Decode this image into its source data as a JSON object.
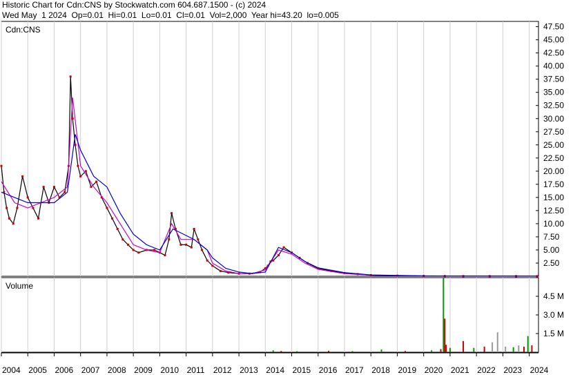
{
  "header": {
    "line1": "Historic Chart for Cdn:CNS by Stockwatch.com 604.687.1500 - (c) 2024",
    "line2": "Wed May  1 2024  Op=0.01  Hi=0.01  Lo=0.01  Cl=0.01  Vol=2,000  Year hi=43.20  lo=0.005"
  },
  "chart_data": [
    {
      "type": "line",
      "panel": "price",
      "title": "Cdn:CNS",
      "ylim": [
        0,
        48.5
      ],
      "y_ticks": [
        "2.50",
        "5.00",
        "7.50",
        "10.00",
        "12.50",
        "15.00",
        "17.50",
        "20.00",
        "22.50",
        "25.00",
        "27.50",
        "30.00",
        "32.50",
        "35.00",
        "37.50",
        "40.00",
        "42.50",
        "45.00",
        "47.50"
      ],
      "x_labels": [
        "2004",
        "2005",
        "2006",
        "2007",
        "2008",
        "2009",
        "2010",
        "2011",
        "2012",
        "2013",
        "2014",
        "2015",
        "2016",
        "2017",
        "2018",
        "2019",
        "2020",
        "2021",
        "2022",
        "2023",
        "2024"
      ],
      "xlim": [
        2004.0,
        2024.35
      ],
      "colors": {
        "bar": "#000000",
        "close_mark": "#cc0000",
        "ma_short": "#cc00cc",
        "ma_long": "#0000cc"
      },
      "series": [
        {
          "role": "close",
          "x": [
            2004.0,
            2004.1,
            2004.2,
            2004.3,
            2004.45,
            2004.6,
            2004.8,
            2005.0,
            2005.2,
            2005.4,
            2005.6,
            2005.8,
            2006.0,
            2006.2,
            2006.4,
            2006.55,
            2006.62,
            2006.7,
            2006.8,
            2006.9,
            2007.0,
            2007.2,
            2007.4,
            2007.6,
            2007.8,
            2008.0,
            2008.2,
            2008.4,
            2008.6,
            2008.8,
            2009.0,
            2009.2,
            2009.5,
            2009.8,
            2010.0,
            2010.2,
            2010.35,
            2010.45,
            2010.6,
            2010.8,
            2011.0,
            2011.2,
            2011.3,
            2011.45,
            2011.6,
            2011.8,
            2012.0,
            2012.3,
            2012.6,
            2013.0,
            2013.4,
            2013.8,
            2014.0,
            2014.1,
            2014.2,
            2014.3,
            2014.5,
            2014.7,
            2015.0,
            2015.3,
            2015.6,
            2016.0,
            2016.5,
            2017.0,
            2017.5,
            2018.0,
            2019.0,
            2020.0,
            2020.8,
            2021.5,
            2022.5,
            2023.5,
            2024.3
          ],
          "y": [
            21,
            16,
            13,
            11,
            10,
            13,
            19,
            15,
            13,
            11,
            17,
            14,
            17,
            15,
            16,
            21,
            38,
            30,
            25,
            21,
            19,
            20,
            17,
            18,
            15,
            13,
            11,
            9,
            7,
            6,
            5,
            4.5,
            5,
            5,
            4.5,
            4,
            7,
            12,
            9,
            6,
            6,
            5.5,
            9,
            7,
            5,
            3,
            2,
            1,
            0.7,
            0.5,
            0.5,
            0.8,
            1.5,
            2,
            2.8,
            3,
            4,
            5.5,
            4.5,
            3.5,
            2.5,
            1.5,
            1.0,
            0.6,
            0.4,
            0.2,
            0.1,
            0.05,
            0.03,
            0.02,
            0.02,
            0.01,
            0.01
          ]
        },
        {
          "role": "ma_short",
          "x": [
            2004.0,
            2004.5,
            2005.0,
            2005.5,
            2006.0,
            2006.5,
            2006.7,
            2007.0,
            2007.5,
            2008.0,
            2008.5,
            2009.0,
            2009.5,
            2010.0,
            2010.45,
            2010.8,
            2011.3,
            2011.8,
            2012.0,
            2012.5,
            2013.0,
            2013.5,
            2014.0,
            2014.5,
            2015.0,
            2015.5,
            2016.0,
            2017.0,
            2018.0,
            2020.0,
            2024.3
          ],
          "y": [
            18,
            14,
            13,
            14,
            15,
            17,
            34,
            21,
            17,
            14,
            10,
            6,
            5,
            4.5,
            10,
            7,
            7,
            5,
            2.5,
            1,
            0.5,
            0.5,
            1.2,
            5.0,
            4.2,
            2.5,
            1.3,
            0.5,
            0.2,
            0.05,
            0.02
          ]
        },
        {
          "role": "ma_long",
          "x": [
            2004.0,
            2004.5,
            2005.0,
            2005.5,
            2006.0,
            2006.5,
            2006.8,
            2007.0,
            2007.5,
            2008.0,
            2008.5,
            2009.0,
            2009.5,
            2010.0,
            2010.5,
            2010.9,
            2011.3,
            2011.8,
            2012.0,
            2012.5,
            2013.0,
            2013.5,
            2014.0,
            2014.5,
            2015.0,
            2015.5,
            2016.0,
            2017.0,
            2018.0,
            2020.0,
            2024.3
          ],
          "y": [
            16,
            15,
            14,
            14,
            14,
            16,
            27,
            24,
            19,
            17,
            12,
            8,
            6,
            5,
            9,
            8,
            7,
            5,
            3.5,
            1.5,
            0.8,
            0.5,
            0.8,
            5.5,
            4.5,
            2.8,
            1.6,
            0.7,
            0.25,
            0.06,
            0.02
          ]
        }
      ]
    },
    {
      "type": "bar",
      "panel": "volume",
      "title": "Volume",
      "ylim": [
        0,
        6.0
      ],
      "unit": "M",
      "y_ticks": [
        "1.5 M",
        "3.0 M",
        "4.5 M"
      ],
      "xlim": [
        2004.0,
        2024.35
      ],
      "bars": [
        {
          "x": 2014.3,
          "v": 0.15,
          "color": "#009900"
        },
        {
          "x": 2014.6,
          "v": 0.1,
          "color": "#cc0000"
        },
        {
          "x": 2015.2,
          "v": 0.08,
          "color": "#009900"
        },
        {
          "x": 2016.4,
          "v": 0.12,
          "color": "#cc0000"
        },
        {
          "x": 2017.3,
          "v": 0.09,
          "color": "#009900"
        },
        {
          "x": 2018.4,
          "v": 0.22,
          "color": "#009900"
        },
        {
          "x": 2019.3,
          "v": 0.1,
          "color": "#cc0000"
        },
        {
          "x": 2020.3,
          "v": 0.15,
          "color": "#009900"
        },
        {
          "x": 2020.65,
          "v": 0.25,
          "color": "#cc0000"
        },
        {
          "x": 2020.75,
          "v": 6.0,
          "color": "#009900"
        },
        {
          "x": 2020.8,
          "v": 2.7,
          "color": "#cc0000"
        },
        {
          "x": 2020.85,
          "v": 0.6,
          "color": "#cc0000"
        },
        {
          "x": 2021.0,
          "v": 0.35,
          "color": "#009900"
        },
        {
          "x": 2021.5,
          "v": 0.9,
          "color": "#cc0000"
        },
        {
          "x": 2021.9,
          "v": 0.35,
          "color": "#009900"
        },
        {
          "x": 2022.3,
          "v": 0.45,
          "color": "#cc0000"
        },
        {
          "x": 2022.6,
          "v": 0.8,
          "color": "#999999"
        },
        {
          "x": 2022.8,
          "v": 1.6,
          "color": "#999999"
        },
        {
          "x": 2023.1,
          "v": 0.45,
          "color": "#999999"
        },
        {
          "x": 2023.4,
          "v": 0.4,
          "color": "#009900"
        },
        {
          "x": 2023.6,
          "v": 0.55,
          "color": "#999999"
        },
        {
          "x": 2023.8,
          "v": 0.45,
          "color": "#cc0000"
        },
        {
          "x": 2023.95,
          "v": 1.3,
          "color": "#009900"
        },
        {
          "x": 2024.1,
          "v": 0.55,
          "color": "#cc0000"
        }
      ]
    }
  ]
}
